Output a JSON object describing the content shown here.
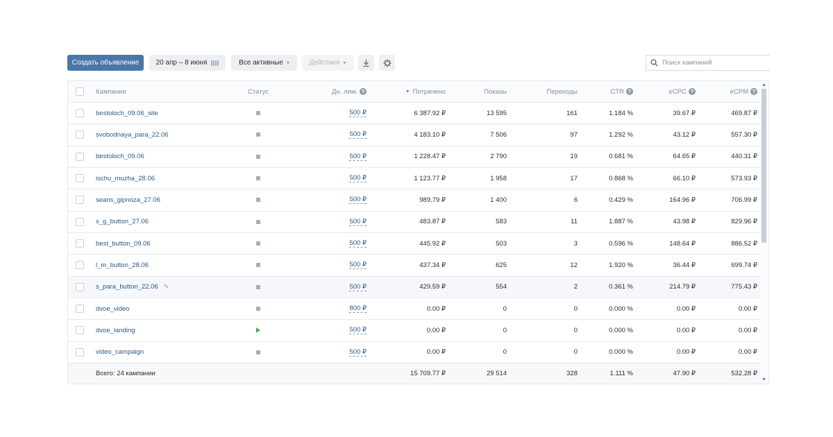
{
  "toolbar": {
    "create_label": "Создать объявление",
    "date_range": "20 апр – 8 июня",
    "filter_label": "Все активные",
    "actions_label": "Действия",
    "download_icon": "download-icon",
    "settings_icon": "gear-icon",
    "search_placeholder": "Поиск кампаний"
  },
  "columns": {
    "campaign": "Кампания",
    "status": "Статус",
    "limit": "Дн. лим.",
    "spent": "Потрачено",
    "shows": "Показы",
    "clicks": "Переходы",
    "ctr": "CTR",
    "ecpc": "eCPC",
    "ecpm": "eCPM"
  },
  "rows": [
    {
      "name": "bestoloch_09.06_site",
      "status": "stopped",
      "limit": "500 ₽",
      "spent": "6 387.92 ₽",
      "shows": "13 595",
      "clicks": "161",
      "ctr": "1.184 %",
      "ecpc": "39.67 ₽",
      "ecpm": "469.87 ₽"
    },
    {
      "name": "svobodnaya_para_22.06",
      "status": "stopped",
      "limit": "500 ₽",
      "spent": "4 183.10 ₽",
      "shows": "7 506",
      "clicks": "97",
      "ctr": "1.292 %",
      "ecpc": "43.12 ₽",
      "ecpm": "557.30 ₽"
    },
    {
      "name": "bestoloch_09.06",
      "status": "stopped",
      "limit": "500 ₽",
      "spent": "1 228.47 ₽",
      "shows": "2 790",
      "clicks": "19",
      "ctr": "0.681 %",
      "ecpc": "64.65 ₽",
      "ecpm": "440.31 ₽"
    },
    {
      "name": "ischu_muzha_28.06",
      "status": "stopped",
      "limit": "500 ₽",
      "spent": "1 123.77 ₽",
      "shows": "1 958",
      "clicks": "17",
      "ctr": "0.868 %",
      "ecpc": "66.10 ₽",
      "ecpm": "573.93 ₽"
    },
    {
      "name": "seans_gipnoza_27.06",
      "status": "stopped",
      "limit": "500 ₽",
      "spent": "989.79 ₽",
      "shows": "1 400",
      "clicks": "6",
      "ctr": "0.429 %",
      "ecpc": "164.96 ₽",
      "ecpm": "706.99 ₽"
    },
    {
      "name": "s_g_button_27.06",
      "status": "stopped",
      "limit": "500 ₽",
      "spent": "483.87 ₽",
      "shows": "583",
      "clicks": "11",
      "ctr": "1.887 %",
      "ecpc": "43.98 ₽",
      "ecpm": "829.96 ₽"
    },
    {
      "name": "best_button_09.06",
      "status": "stopped",
      "limit": "500 ₽",
      "spent": "445.92 ₽",
      "shows": "503",
      "clicks": "3",
      "ctr": "0.596 %",
      "ecpc": "148.64 ₽",
      "ecpm": "886.52 ₽"
    },
    {
      "name": "l_m_button_28.06",
      "status": "stopped",
      "limit": "500 ₽",
      "spent": "437.34 ₽",
      "shows": "625",
      "clicks": "12",
      "ctr": "1.920 %",
      "ecpc": "36.44 ₽",
      "ecpm": "699.74 ₽"
    },
    {
      "name": "s_para_button_22.06",
      "status": "stopped",
      "limit": "500 ₽",
      "spent": "429.59 ₽",
      "shows": "554",
      "clicks": "2",
      "ctr": "0.361 %",
      "ecpc": "214.79 ₽",
      "ecpm": "775.43 ₽",
      "hovered": true
    },
    {
      "name": "dvoe_video",
      "status": "stopped",
      "limit": "800 ₽",
      "spent": "0.00 ₽",
      "shows": "0",
      "clicks": "0",
      "ctr": "0.000 %",
      "ecpc": "0.00 ₽",
      "ecpm": "0.00 ₽"
    },
    {
      "name": "dvoe_landing",
      "status": "running",
      "limit": "500 ₽",
      "spent": "0.00 ₽",
      "shows": "0",
      "clicks": "0",
      "ctr": "0.000 %",
      "ecpc": "0.00 ₽",
      "ecpm": "0.00 ₽"
    },
    {
      "name": "video_campaign",
      "status": "stopped",
      "limit": "500 ₽",
      "spent": "0.00 ₽",
      "shows": "0",
      "clicks": "0",
      "ctr": "0.000 %",
      "ecpc": "0.00 ₽",
      "ecpm": "0.00 ₽"
    }
  ],
  "totals": {
    "label": "Всего: 24 кампании",
    "spent": "15 709.77 ₽",
    "shows": "29 514",
    "clicks": "328",
    "ctr": "1.111 %",
    "ecpc": "47.90 ₽",
    "ecpm": "532.28 ₽"
  },
  "colors": {
    "accent": "#4a76a8",
    "link": "#2a5885",
    "running": "#4bb34b",
    "stopped": "#a6afb8"
  }
}
